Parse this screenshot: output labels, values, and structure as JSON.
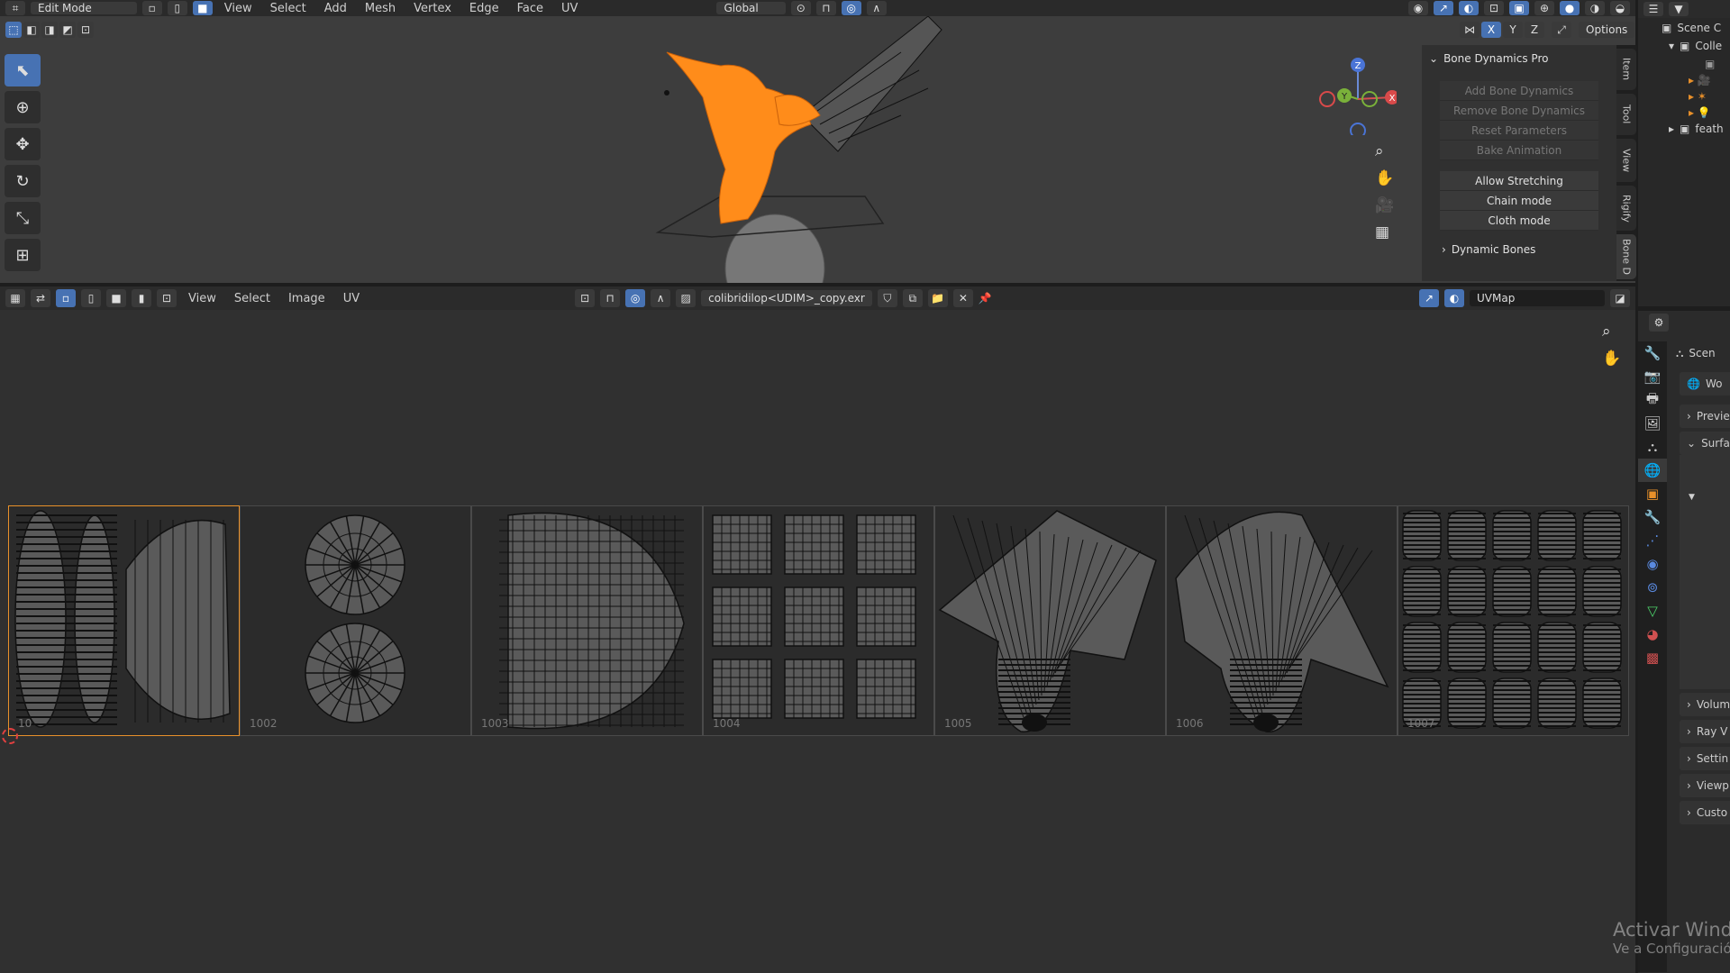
{
  "top_header": {
    "mode": "Edit Mode",
    "menus": [
      "View",
      "Select",
      "Add",
      "Mesh",
      "Vertex",
      "Edge",
      "Face",
      "UV"
    ],
    "orientation": "Global",
    "options": "Options",
    "axes": [
      "X",
      "Y",
      "Z"
    ]
  },
  "outliner": {
    "title": "Scene C",
    "items": [
      "Colle",
      "",
      "",
      "",
      "",
      "feath"
    ]
  },
  "n_panel": {
    "title": "Bone Dynamics Pro",
    "buttons_disabled": [
      "Add Bone Dynamics",
      "Remove Bone Dynamics",
      "Reset Parameters",
      "Bake Animation"
    ],
    "buttons": [
      "Allow Stretching",
      "Chain mode",
      "Cloth mode"
    ],
    "subpanel": "Dynamic Bones",
    "tabs": [
      "Item",
      "Tool",
      "View",
      "Rigify",
      "Bone D"
    ]
  },
  "gizmo": {
    "z": "Z",
    "y": "Y",
    "x": "X"
  },
  "uv_header": {
    "menus": [
      "View",
      "Select",
      "Image",
      "UV"
    ],
    "image_name": "colibridilop<UDIM>_copy.exr",
    "uv_map": "UVMap"
  },
  "uv_tiles": [
    "10",
    "1002",
    "1003",
    "1004",
    "1005",
    "1006",
    "1007"
  ],
  "properties": {
    "scene": "Scen",
    "world": "Wo",
    "panels": [
      "Previe",
      "Surfac",
      "Volum",
      "Ray V",
      "Settin",
      "Viewp",
      "Custo"
    ]
  },
  "watermark": {
    "line1": "Activar Windows",
    "line2": "Ve a Configuración"
  },
  "colors": {
    "accent": "#4772b3",
    "selection": "#ff8c1a",
    "background": "#1d1d1d"
  }
}
